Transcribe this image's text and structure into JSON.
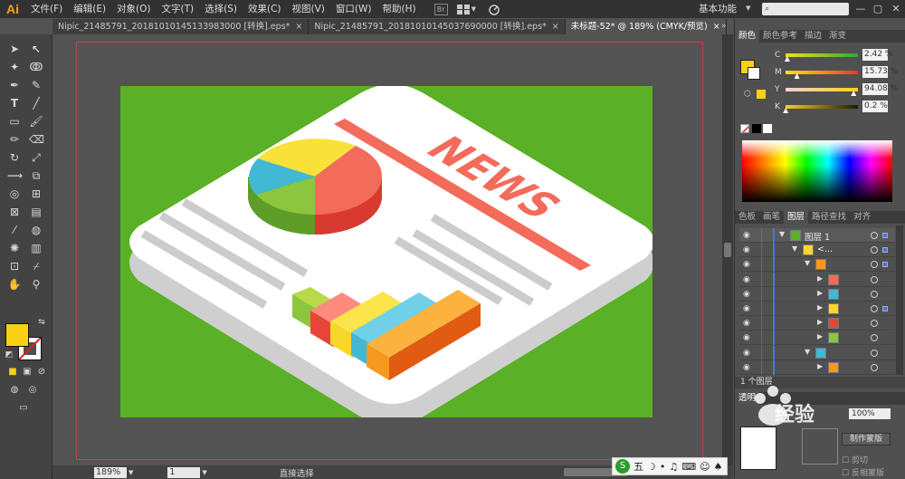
{
  "app": {
    "logo": "Ai",
    "menu": [
      "文件(F)",
      "编辑(E)",
      "对象(O)",
      "文字(T)",
      "选择(S)",
      "效果(C)",
      "视图(V)",
      "窗口(W)",
      "帮助(H)"
    ],
    "bridge_label": "Br",
    "workspace": "基本功能",
    "window_controls": {
      "minimize": "—",
      "restore": "▢",
      "close": "✕"
    }
  },
  "tabs": [
    {
      "label": "Nipic_21485791_20181010145133983000 [转换].eps*",
      "close": "×"
    },
    {
      "label": "Nipic_21485791_20181010145037690000 [转换].eps*",
      "close": "×"
    },
    {
      "label": "未标题-52* @ 189% (CMYK/预览)",
      "close": "×"
    }
  ],
  "artwork": {
    "headline": "NEWS",
    "colors": {
      "background": "#5ab026",
      "paper": "#ffffff",
      "paper_edge": "#cfcfcf",
      "red": "#f26b5b",
      "yellow": "#f9d72a",
      "cyan": "#41b8d4",
      "green": "#8cc63f",
      "orange": "#f59a1f",
      "gray_lines": "#cccccc"
    },
    "pie_slices": [
      {
        "color": "#f26b5b",
        "share": 0.45
      },
      {
        "color": "#8cc63f",
        "share": 0.22
      },
      {
        "color": "#41b8d4",
        "share": 0.13
      },
      {
        "color": "#f9d72a",
        "share": 0.2
      }
    ]
  },
  "status": {
    "zoom": "189%",
    "page": "1",
    "tool": "直接选择"
  },
  "color_panel": {
    "tabs": [
      "颜色",
      "颜色参考",
      "描边",
      "渐变"
    ],
    "channels": [
      {
        "label": "C",
        "value": "2.42",
        "unit": "%",
        "position": 0.0242
      },
      {
        "label": "M",
        "value": "15.73",
        "unit": "%",
        "position": 0.1573
      },
      {
        "label": "Y",
        "value": "94.08",
        "unit": "%",
        "position": 0.9408
      },
      {
        "label": "K",
        "value": "0.2",
        "unit": "%",
        "position": 0.002
      }
    ],
    "fill_color": "#fbd114"
  },
  "layers_panel": {
    "tabs": [
      "色板",
      "画笔",
      "图层",
      "路径查找",
      "对齐"
    ],
    "layer_name": "图层 1",
    "sublayer_name": "<...",
    "count": "1 个图层",
    "rows": [
      {
        "indent": 0,
        "label": "图层 1",
        "expanded": true
      },
      {
        "indent": 1,
        "label": "<...",
        "expanded": true
      },
      {
        "indent": 2,
        "label": "",
        "expanded": true
      },
      {
        "indent": 3,
        "label": "",
        "expanded": false
      },
      {
        "indent": 3,
        "label": "",
        "expanded": false
      },
      {
        "indent": 3,
        "label": "",
        "expanded": false
      },
      {
        "indent": 3,
        "label": "",
        "expanded": false
      },
      {
        "indent": 3,
        "label": "",
        "expanded": false
      },
      {
        "indent": 2,
        "label": "",
        "expanded": true
      },
      {
        "indent": 3,
        "label": "",
        "expanded": false
      }
    ]
  },
  "transparency_panel": {
    "tab": "透明",
    "opacity": "100%",
    "make_mask": "制作蒙版",
    "clip": "剪切",
    "invert_mask": "反相蒙版"
  },
  "watermark": "经验"
}
